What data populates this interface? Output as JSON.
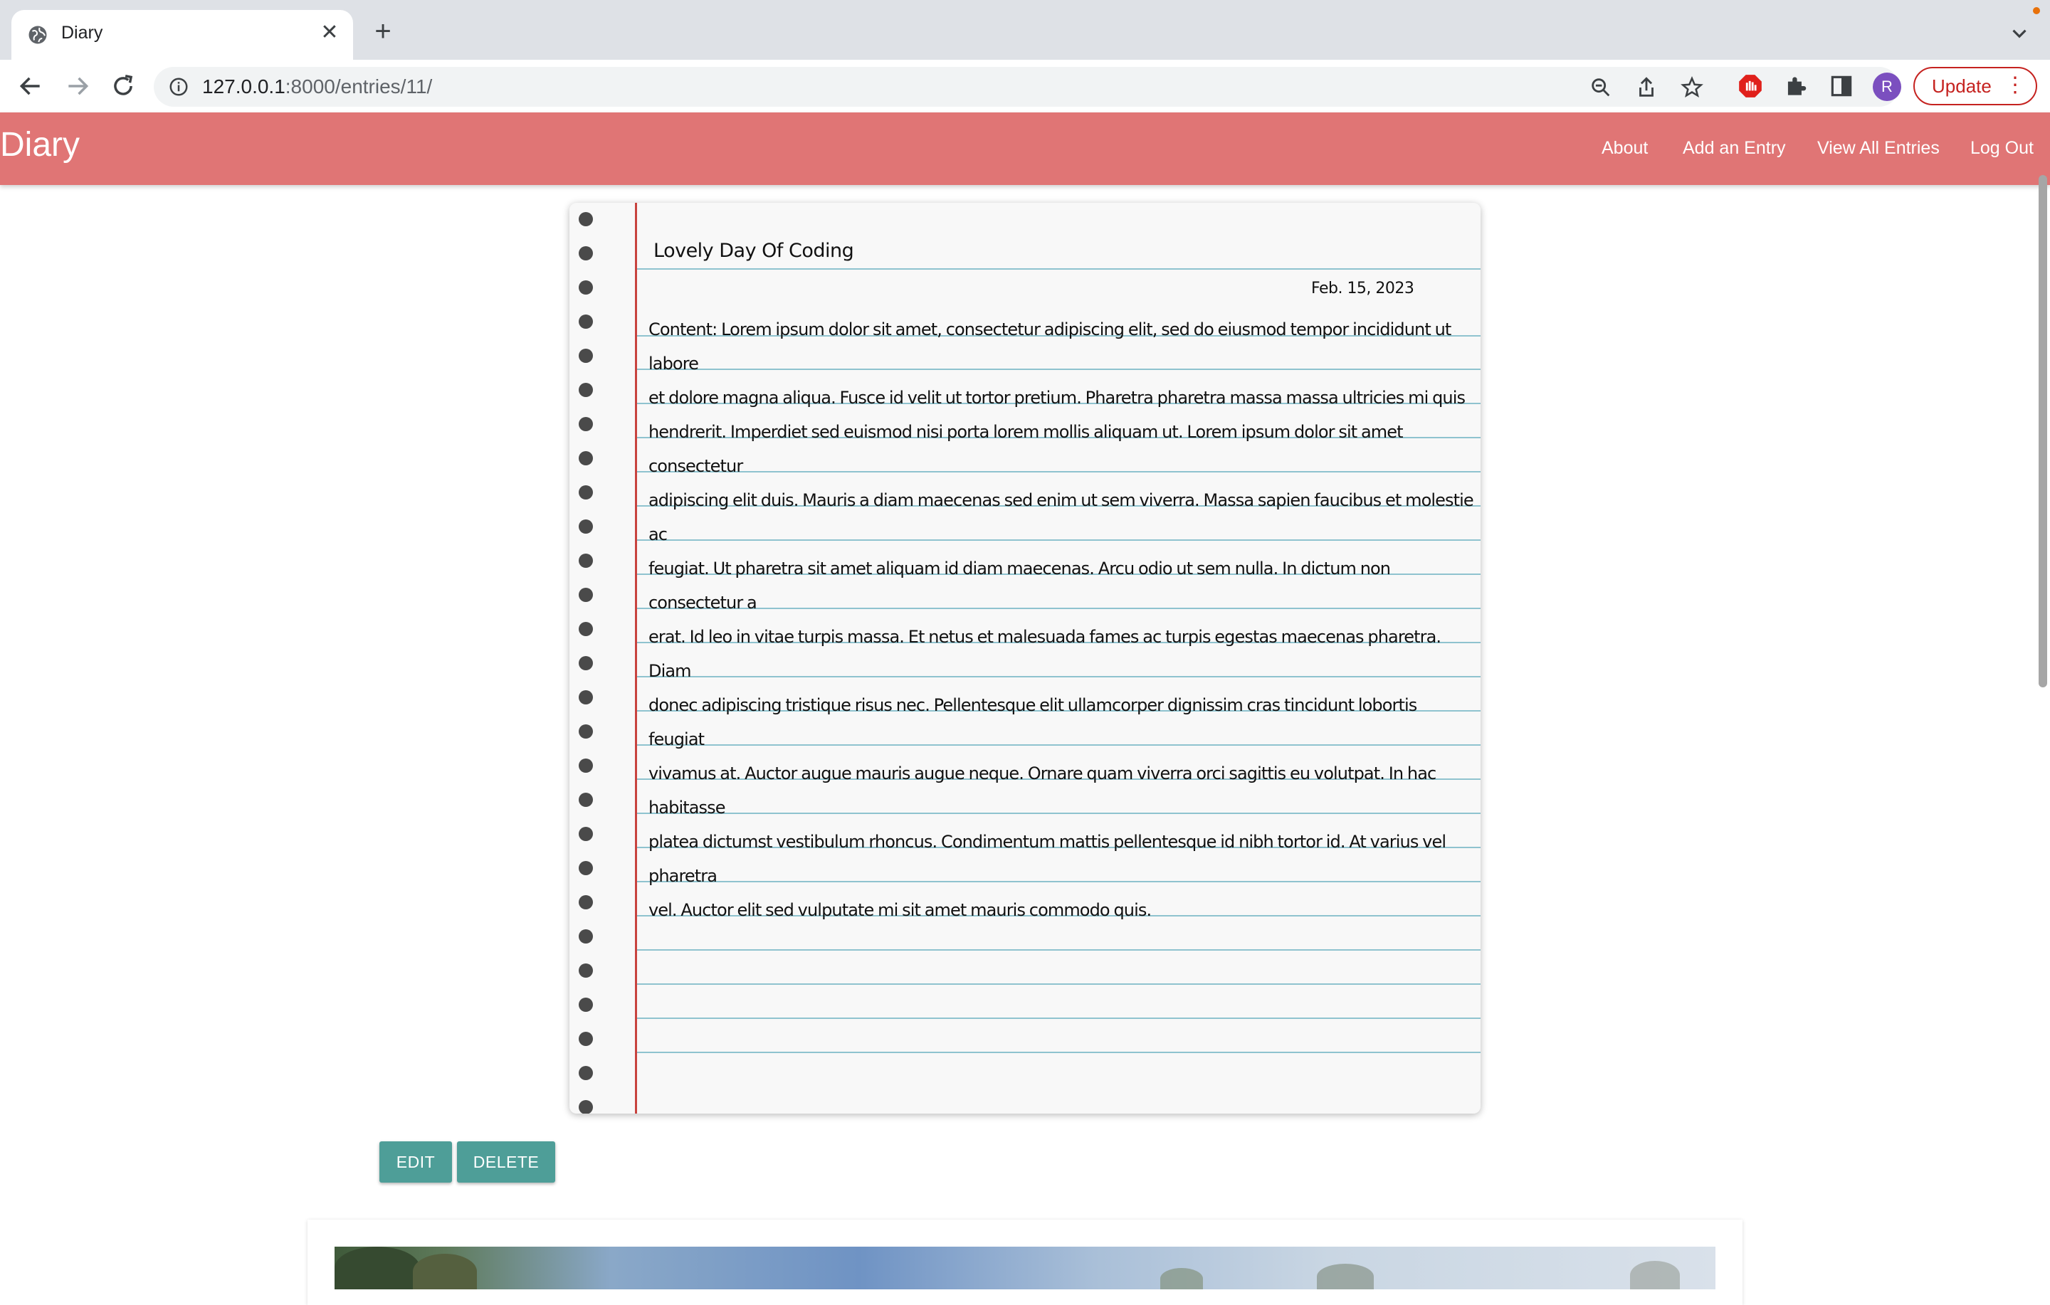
{
  "browser": {
    "tab_title": "Diary",
    "url_host": "127.0.0.1",
    "url_rest": ":8000/entries/11/",
    "profile_initial": "R",
    "update_label": "Update"
  },
  "navbar": {
    "brand": "Diary",
    "links": [
      "About",
      "Add an Entry",
      "View All Entries",
      "Log Out"
    ]
  },
  "entry": {
    "title": "Lovely Day Of Coding",
    "date": "Feb. 15, 2023",
    "content_lines": [
      "Content: Lorem ipsum dolor sit amet, consectetur adipiscing elit, sed do eiusmod tempor incididunt ut labore",
      "et dolore magna aliqua. Fusce id velit ut tortor pretium. Pharetra pharetra massa massa ultricies mi quis",
      "hendrerit. Imperdiet sed euismod nisi porta lorem mollis aliquam ut. Lorem ipsum dolor sit amet consectetur",
      "adipiscing elit duis. Mauris a diam maecenas sed enim ut sem viverra. Massa sapien faucibus et molestie ac",
      "feugiat. Ut pharetra sit amet aliquam id diam maecenas. Arcu odio ut sem nulla. In dictum non consectetur a",
      "erat. Id leo in vitae turpis massa. Et netus et malesuada fames ac turpis egestas maecenas pharetra. Diam",
      "donec adipiscing tristique risus nec. Pellentesque elit ullamcorper dignissim cras tincidunt lobortis feugiat",
      "vivamus at. Auctor augue mauris augue neque. Ornare quam viverra orci sagittis eu volutpat. In hac habitasse",
      "platea dictumst vestibulum rhoncus. Condimentum mattis pellentesque id nibh tortor id. At varius vel pharetra",
      "vel. Auctor elit sed vulputate mi sit amet mauris commodo quis."
    ]
  },
  "actions": {
    "edit_label": "EDIT",
    "delete_label": "DELETE"
  },
  "colors": {
    "navbar": "#e07575",
    "button": "#4e9e98",
    "margin_line": "#c8433e",
    "ruled_line": "#8fc3cf"
  },
  "icons": [
    "globe-icon",
    "close-icon",
    "plus-icon",
    "back-icon",
    "forward-icon",
    "reload-icon",
    "info-icon",
    "zoom-icon",
    "share-icon",
    "star-icon",
    "adblock-icon",
    "extensions-icon",
    "side-panel-icon",
    "menu-icon"
  ]
}
